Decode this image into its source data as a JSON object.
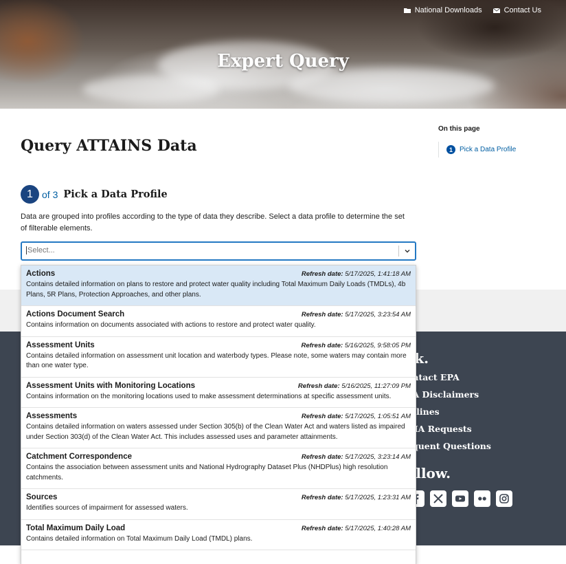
{
  "header": {
    "links": [
      {
        "label": "National Downloads",
        "icon": "folder-icon"
      },
      {
        "label": "Contact Us",
        "icon": "envelope-icon"
      }
    ],
    "title": "Expert Query"
  },
  "main": {
    "title": "Query ATTAINS Data",
    "step": {
      "number": "1",
      "of_text": "of 3",
      "title": "Pick a Data Profile"
    },
    "description": "Data are grouped into profiles according to the type of data they describe. Select a data profile to determine the set of filterable elements.",
    "select": {
      "placeholder": "Select..."
    }
  },
  "on_this_page": {
    "heading": "On this page",
    "items": [
      {
        "number": "1",
        "label": "Pick a Data Profile"
      }
    ]
  },
  "dropdown": {
    "refresh_label": "Refresh date:",
    "options": [
      {
        "label": "Actions",
        "refresh_date": "5/17/2025, 1:41:18 AM",
        "description": "Contains detailed information on plans to restore and protect water quality including Total Maximum Daily Loads (TMDLs), 4b Plans, 5R Plans, Protection Approaches, and other plans."
      },
      {
        "label": "Actions Document Search",
        "refresh_date": "5/17/2025, 3:23:54 AM",
        "description": "Contains information on documents associated with actions to restore and protect water quality."
      },
      {
        "label": "Assessment Units",
        "refresh_date": "5/16/2025, 9:58:05 PM",
        "description": "Contains detailed information on assessment unit location and waterbody types. Please note, some waters may contain more than one water type."
      },
      {
        "label": "Assessment Units with Monitoring Locations",
        "refresh_date": "5/16/2025, 11:27:09 PM",
        "description": "Contains information on the monitoring locations used to make assessment determinations at specific assessment units."
      },
      {
        "label": "Assessments",
        "refresh_date": "5/17/2025, 1:05:51 AM",
        "description": "Contains detailed information on waters assessed under Section 305(b) of the Clean Water Act and waters listed as impaired under Section 303(d) of the Clean Water Act. This includes assessed uses and parameter attainments."
      },
      {
        "label": "Catchment Correspondence",
        "refresh_date": "5/17/2025, 3:23:14 AM",
        "description": "Contains the association between assessment units and National Hydrography Dataset Plus (NHDPlus) high resolution catchments."
      },
      {
        "label": "Sources",
        "refresh_date": "5/17/2025, 1:23:31 AM",
        "description": "Identifies sources of impairment for assessed waters."
      },
      {
        "label": "Total Maximum Daily Load",
        "refresh_date": "5/17/2025, 1:40:28 AM",
        "description": "Contains detailed information on Total Maximum Daily Load (TMDL) plans."
      }
    ]
  },
  "footer": {
    "ask_heading": "sk.",
    "links": [
      "ontact EPA",
      "PA Disclaimers",
      "otlines",
      "DIA Requests",
      "equent Questions"
    ],
    "follow_heading": "ollow.",
    "social_icons": [
      "facebook-icon",
      "x-icon",
      "youtube-icon",
      "flickr-icon",
      "instagram-icon"
    ]
  },
  "colors": {
    "accent": "#005ea2",
    "step_circle": "#1a4480",
    "select_border": "#2378c3",
    "highlight": "#d9e8f6",
    "footer_bg": "#3d4551"
  }
}
